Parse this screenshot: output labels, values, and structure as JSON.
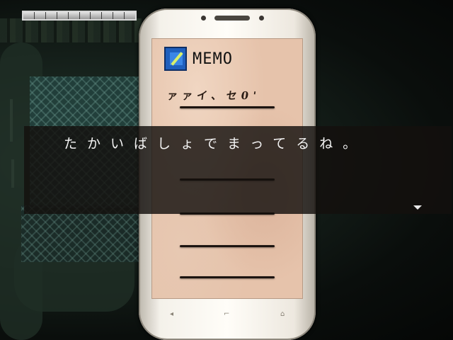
{
  "hud": {
    "gauge_segments": 10,
    "gauge_filled": 10
  },
  "phone": {
    "app_title": "MEMO",
    "app_icon": "memo-pen-icon",
    "handwritten_note": "ァァイ、セ0'",
    "bottom_left_glyph": "◂",
    "bottom_center_glyph": "⌐",
    "bottom_right_glyph": "⌂"
  },
  "dialogue": {
    "text": "たかいばしょでまってるね。",
    "advance_icon": "down-triangle-icon"
  },
  "colors": {
    "message_window": "#14100e",
    "memo_icon": "#1f5fbd",
    "memo_paper": "#e6c3ab"
  }
}
